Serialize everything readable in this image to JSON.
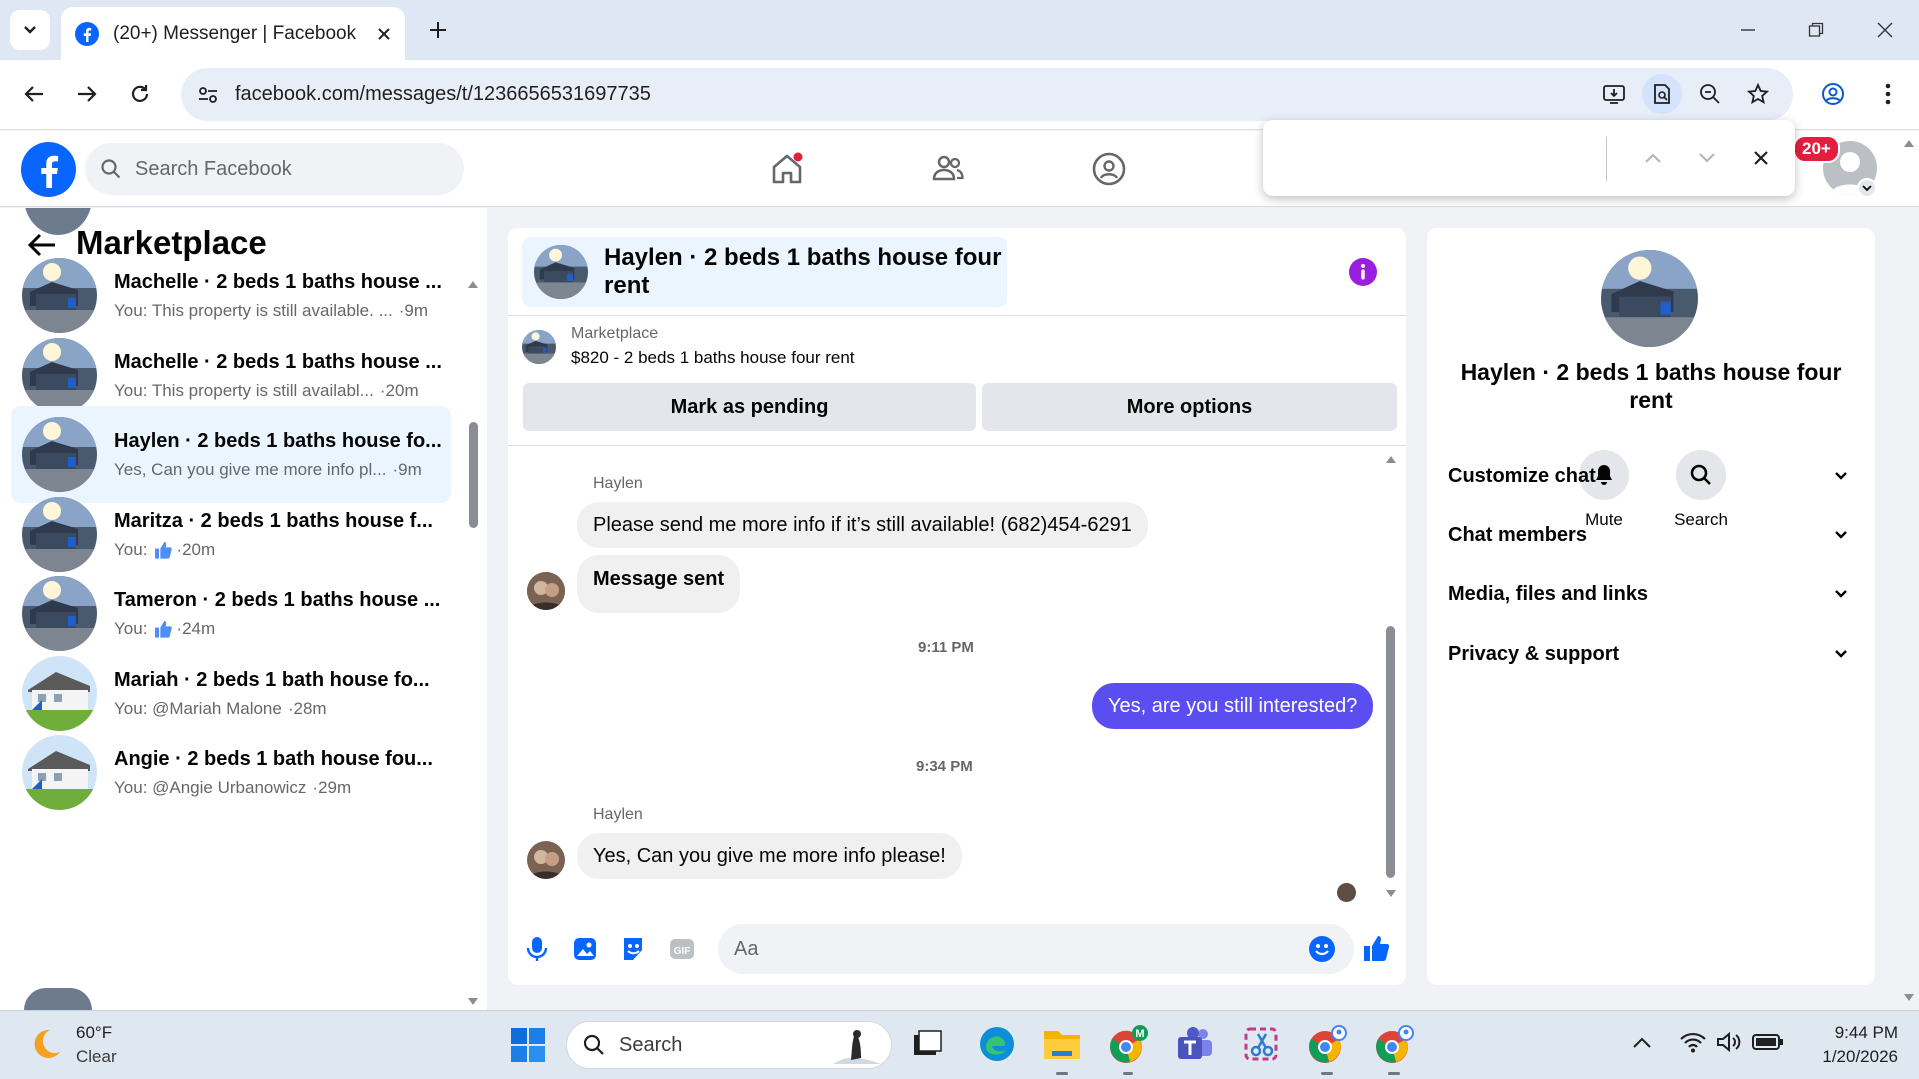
{
  "browser": {
    "tab_title": "(20+) Messenger | Facebook",
    "url": "facebook.com/messages/t/1236656531697735"
  },
  "fb": {
    "search_placeholder": "Search Facebook",
    "notification_badge": "20+"
  },
  "left": {
    "title": "Marketplace",
    "conversations": [
      {
        "name": "Machelle · 2 beds 1 baths house ...",
        "preview": "You: This property is still available. ...",
        "time": "9m"
      },
      {
        "name": "Machelle · 2 beds 1 baths house ...",
        "preview": "You: This property is still availabl...",
        "time": "20m"
      },
      {
        "name": "Haylen · 2 beds 1 baths house fo...",
        "preview": "Yes, Can you give me more info pl...",
        "time": "9m"
      },
      {
        "name": "Maritza · 2 beds 1 baths house f...",
        "preview": "You:",
        "time": "20m"
      },
      {
        "name": "Tameron · 2 beds 1 baths house ...",
        "preview": "You:",
        "time": "24m"
      },
      {
        "name": "Mariah · 2 beds 1 bath house fo...",
        "preview": "You: @Mariah Malone",
        "time": "28m"
      },
      {
        "name": "Angie · 2 beds 1 bath house fou...",
        "preview": "You: @Angie Urbanowicz",
        "time": "29m"
      }
    ]
  },
  "chat": {
    "title": "Haylen · 2 beds 1 baths house four rent",
    "marketplace_label": "Marketplace",
    "listing": "$820 - 2 beds 1 baths house four rent",
    "mark_pending": "Mark as pending",
    "more_options": "More options",
    "messages": {
      "sender1": "Haylen",
      "msg1": "Please send me more info if it’s still available! (682)454-6291",
      "msg2": "Message sent",
      "time1": "9:11 PM",
      "msg3": "Yes, are you still interested?",
      "time2": "9:34 PM",
      "sender2": "Haylen",
      "msg4": "Yes, Can you give me more info please!"
    },
    "composer_placeholder": "Aa"
  },
  "right": {
    "title": "Haylen · 2 beds 1 baths house four rent",
    "mute": "Mute",
    "search": "Search",
    "sections": [
      "Customize chat",
      "Chat members",
      "Media, files and links",
      "Privacy & support"
    ]
  },
  "taskbar": {
    "temp": "60°F",
    "weather": "Clear",
    "search": "Search",
    "time": "9:44 PM",
    "date": "1/20/2026"
  },
  "colors": {
    "fb_blue": "#0866ff",
    "messenger_purple": "#5b4ef0",
    "active_row": "#ebf5ff"
  }
}
